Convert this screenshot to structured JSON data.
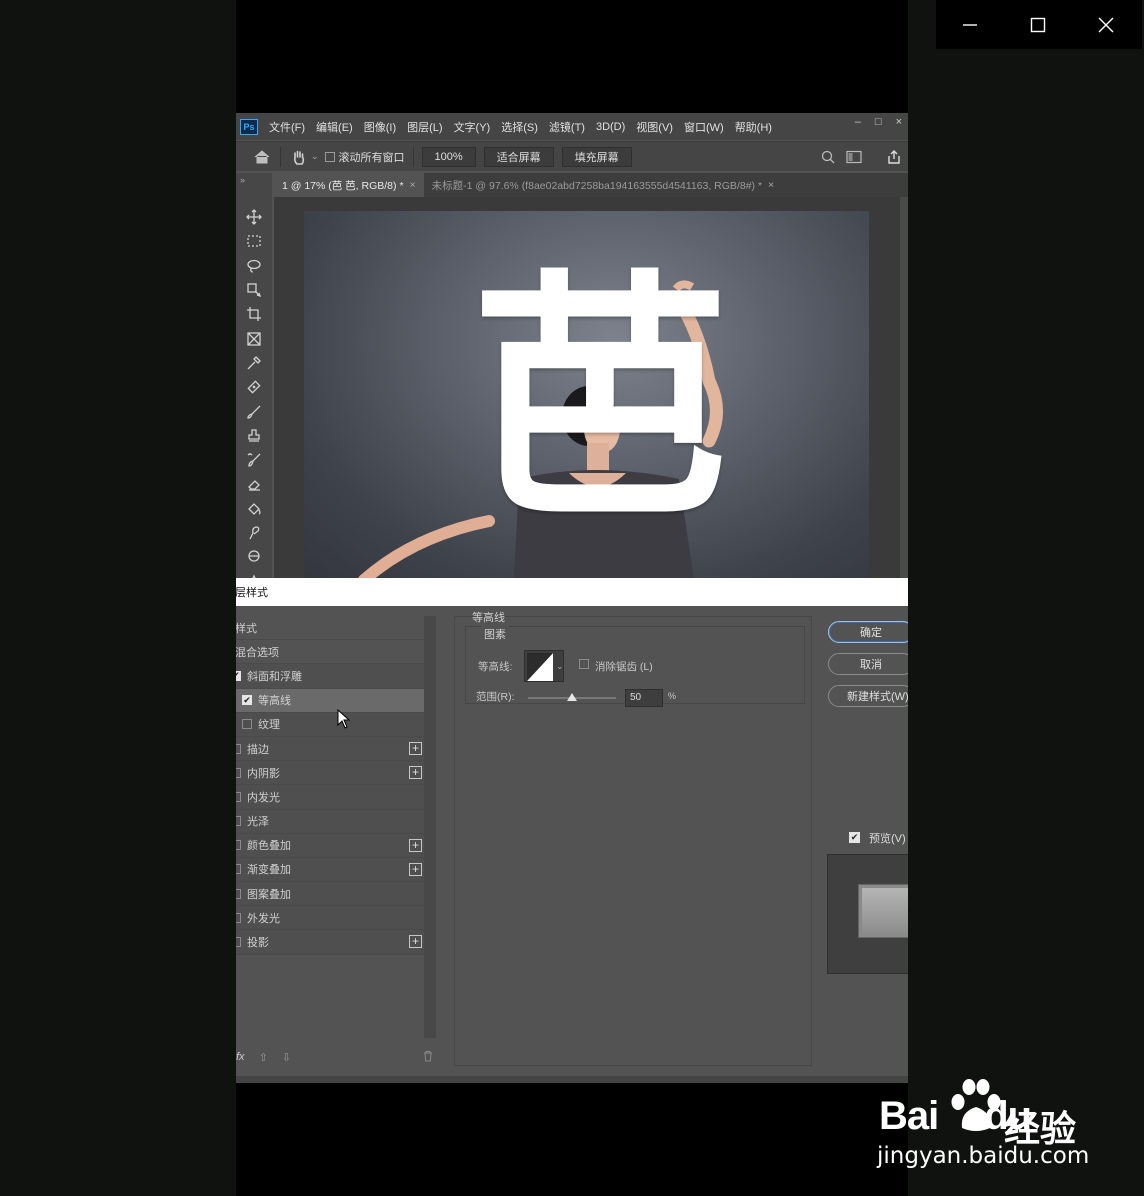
{
  "viewer": {
    "controls": [
      "minimize",
      "maximize",
      "close"
    ]
  },
  "photoshop": {
    "logo": "Ps",
    "menu": [
      "文件(F)",
      "编辑(E)",
      "图像(I)",
      "图层(L)",
      "文字(Y)",
      "选择(S)",
      "滤镜(T)",
      "3D(D)",
      "视图(V)",
      "窗口(W)",
      "帮助(H)"
    ],
    "window_controls": [
      "–",
      "□",
      "×"
    ],
    "options_bar": {
      "scroll_all_label": "滚动所有窗口",
      "zoom_value": "100%",
      "fit_screen_label": "适合屏幕",
      "fill_screen_label": "填充屏幕"
    },
    "toolbar_collapse": "»",
    "tabs": [
      {
        "label": "1 @ 17% (芭 芭, RGB/8) *",
        "close": "×"
      },
      {
        "label": "未标题-1 @ 97.6% (f8ae02abd7258ba194163555d4541163, RGB/8#) *",
        "close": "×"
      }
    ],
    "canvas_text": "芭"
  },
  "layer_style": {
    "title": "图层样式",
    "list": [
      {
        "label": "样式",
        "kind": "header",
        "checkbox": false,
        "checked": false,
        "plus": false
      },
      {
        "label": "混合选项",
        "kind": "header",
        "checkbox": false,
        "checked": false,
        "plus": false
      },
      {
        "label": "斜面和浮雕",
        "kind": "row",
        "checkbox": true,
        "checked": true,
        "plus": false
      },
      {
        "label": "等高线",
        "kind": "selected",
        "checkbox": true,
        "checked": true,
        "plus": false
      },
      {
        "label": "纹理",
        "kind": "row",
        "checkbox": true,
        "checked": false,
        "plus": false
      },
      {
        "label": "描边",
        "kind": "row",
        "checkbox": true,
        "checked": false,
        "plus": true
      },
      {
        "label": "内阴影",
        "kind": "row",
        "checkbox": true,
        "checked": false,
        "plus": true
      },
      {
        "label": "内发光",
        "kind": "row",
        "checkbox": true,
        "checked": false,
        "plus": false
      },
      {
        "label": "光泽",
        "kind": "row",
        "checkbox": true,
        "checked": false,
        "plus": false
      },
      {
        "label": "颜色叠加",
        "kind": "row",
        "checkbox": true,
        "checked": false,
        "plus": true
      },
      {
        "label": "渐变叠加",
        "kind": "row",
        "checkbox": true,
        "checked": false,
        "plus": true
      },
      {
        "label": "图案叠加",
        "kind": "row",
        "checkbox": true,
        "checked": false,
        "plus": false
      },
      {
        "label": "外发光",
        "kind": "row",
        "checkbox": true,
        "checked": false,
        "plus": false
      },
      {
        "label": "投影",
        "kind": "row",
        "checkbox": true,
        "checked": false,
        "plus": true
      }
    ],
    "footer": {
      "fx": "fx",
      "up": "⇧",
      "down": "⇩",
      "trash": "🗑"
    },
    "contour_panel": {
      "section_title": "等高线",
      "group_title": "图素",
      "contour_label": "等高线:",
      "antialias_label": "消除锯齿 (L)",
      "range_label": "范围(R):",
      "range_value": "50",
      "range_unit": "%",
      "range_fraction": 0.5
    },
    "buttons": {
      "ok": "确定",
      "cancel": "取消",
      "new_style": "新建样式(W)...",
      "preview_label": "预览(V)"
    }
  },
  "watermark": {
    "brand": "Bai",
    "brand2": "du",
    "suffix": "经验",
    "url": "jingyan.baidu.com"
  }
}
